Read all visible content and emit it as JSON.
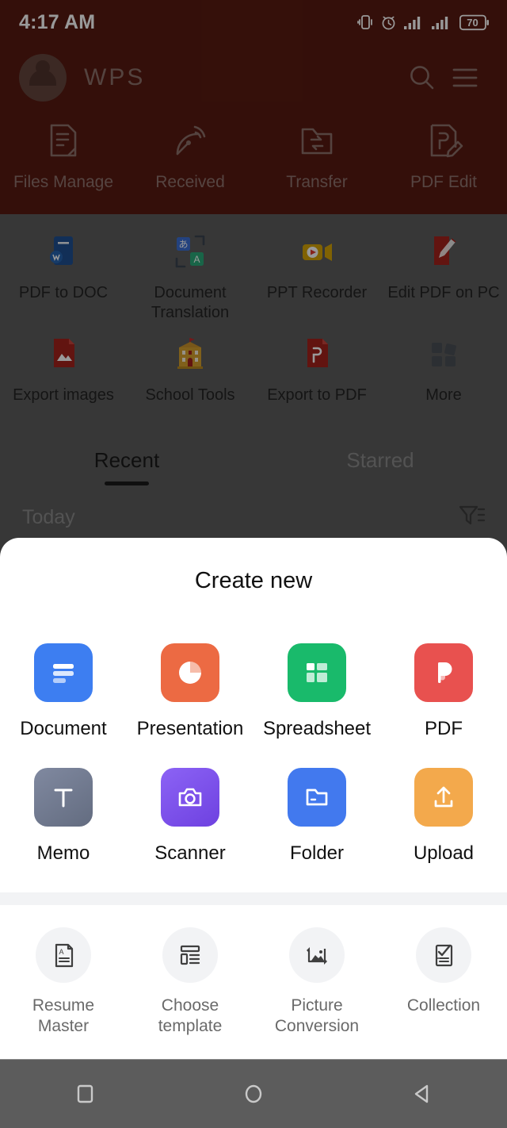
{
  "status_bar": {
    "time": "4:17 AM",
    "battery_level": "70",
    "icons": [
      "vibrate-icon",
      "alarm-icon",
      "signal-bars-icon",
      "signal-bars-icon",
      "battery-icon"
    ]
  },
  "app_bar": {
    "brand": "WPS",
    "avatar": "user-avatar",
    "search_icon": "search-icon",
    "menu_icon": "hamburger-menu-icon"
  },
  "quick_actions": [
    {
      "label": "Files Manage",
      "icon": "document-file-icon"
    },
    {
      "label": "Received",
      "icon": "satellite-dish-icon"
    },
    {
      "label": "Transfer",
      "icon": "folder-transfer-icon"
    },
    {
      "label": "PDF Edit",
      "icon": "pdf-edit-icon"
    }
  ],
  "tools": [
    {
      "label": "PDF to DOC",
      "icon": "pdf-to-doc-icon"
    },
    {
      "label": "Document Translation",
      "icon": "translate-icon"
    },
    {
      "label": "PPT Recorder",
      "icon": "video-camera-icon"
    },
    {
      "label": "Edit PDF on PC",
      "icon": "edit-pdf-pc-icon"
    },
    {
      "label": "Export images",
      "icon": "export-images-icon"
    },
    {
      "label": "School Tools",
      "icon": "school-building-icon"
    },
    {
      "label": "Export to PDF",
      "icon": "export-to-pdf-icon"
    },
    {
      "label": "More",
      "icon": "more-grid-icon"
    }
  ],
  "tabs": [
    {
      "label": "Recent",
      "active": true
    },
    {
      "label": "Starred",
      "active": false
    }
  ],
  "list_header": {
    "section": "Today",
    "filter_icon": "filter-icon"
  },
  "sheet": {
    "title": "Create new",
    "primary": [
      {
        "label": "Document",
        "icon": "document-icon",
        "color": "#3D7EF1"
      },
      {
        "label": "Presentation",
        "icon": "presentation-icon",
        "color": "#EC6A43"
      },
      {
        "label": "Spreadsheet",
        "icon": "spreadsheet-icon",
        "color": "#19BA6B"
      },
      {
        "label": "PDF",
        "icon": "pdf-icon",
        "color": "#E8514F"
      },
      {
        "label": "Memo",
        "icon": "memo-icon",
        "color": "#707B8F"
      },
      {
        "label": "Scanner",
        "icon": "scanner-icon",
        "color": "#7B53EC"
      },
      {
        "label": "Folder",
        "icon": "folder-icon",
        "color": "#4279EE"
      },
      {
        "label": "Upload",
        "icon": "upload-icon",
        "color": "#F3A94C"
      }
    ],
    "secondary": [
      {
        "label": "Resume Master",
        "icon": "resume-document-icon"
      },
      {
        "label": "Choose template",
        "icon": "template-layout-icon"
      },
      {
        "label": "Picture Conversion",
        "icon": "picture-convert-icon"
      },
      {
        "label": "Collection",
        "icon": "checklist-icon"
      }
    ]
  },
  "nav_bar": [
    {
      "label": "Recents",
      "icon": "square-recents-icon"
    },
    {
      "label": "Home",
      "icon": "circle-home-icon"
    },
    {
      "label": "Back",
      "icon": "triangle-back-icon"
    }
  ],
  "colors": {
    "header_maroon": "#581A11",
    "scrim": "rgba(0,0,0,0.40)",
    "sheet_bg": "#FFFFFF",
    "nav_bg": "#5C5C5C"
  }
}
